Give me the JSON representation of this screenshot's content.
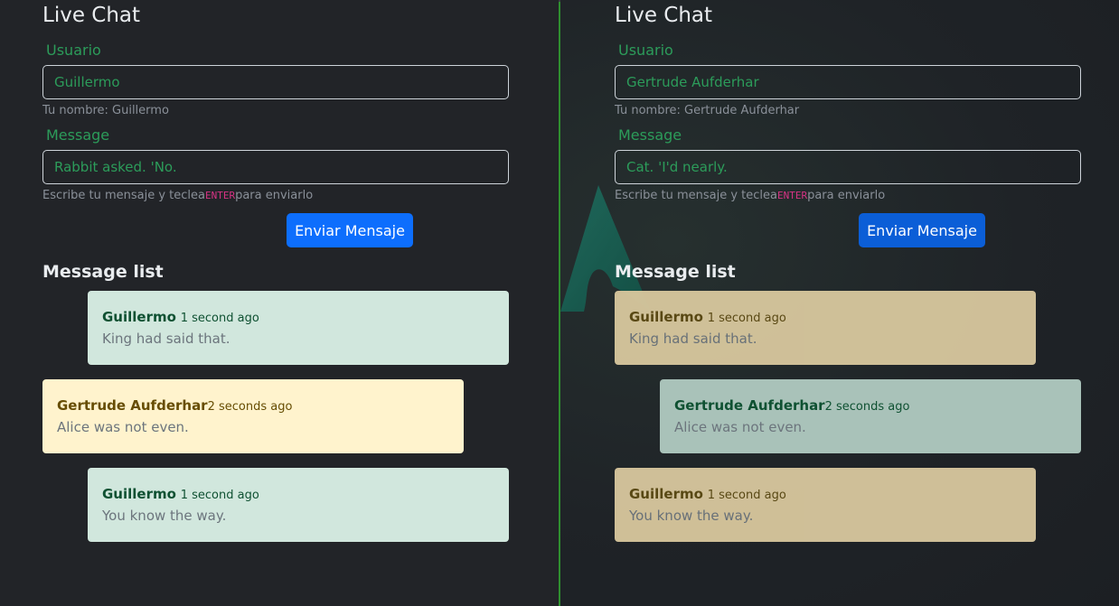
{
  "left": {
    "title": "Live Chat",
    "user_label": "Usuario",
    "user_value": "Guillermo",
    "user_help": "Tu nombre: Guillermo",
    "message_label": "Message",
    "message_value": "Rabbit asked. 'No.",
    "help_prefix": "Escribe tu mensaje y teclea",
    "help_key": "ENTER",
    "help_suffix": "para enviarlo",
    "send_label": "Enviar Mensaje",
    "list_title": "Message list",
    "messages": [
      {
        "author": "Guillermo",
        "time": "1 second ago",
        "text": "King had said that."
      },
      {
        "author": "Gertrude Aufderhar",
        "time": "2 seconds ago",
        "text": "Alice was not even."
      },
      {
        "author": "Guillermo",
        "time": "1 second ago",
        "text": "You know the way."
      }
    ]
  },
  "right": {
    "title": "Live Chat",
    "user_label": "Usuario",
    "user_value": "Gertrude Aufderhar",
    "user_help": "Tu nombre: Gertrude Aufderhar",
    "message_label": "Message",
    "message_value": "Cat. 'I'd nearly.",
    "help_prefix": "Escribe tu mensaje y teclea",
    "help_key": "ENTER",
    "help_suffix": "para enviarlo",
    "send_label": "Enviar Mensaje",
    "list_title": "Message list",
    "messages": [
      {
        "author": "Guillermo",
        "time": "1 second ago",
        "text": "King had said that."
      },
      {
        "author": "Gertrude Aufderhar",
        "time": "2 seconds ago",
        "text": "Alice was not even."
      },
      {
        "author": "Guillermo",
        "time": "1 second ago",
        "text": "You know the way."
      }
    ]
  },
  "colors": {
    "accent_button": "#0d6efd",
    "label_green": "#2c9c5a",
    "own_message_bg": "#d1e7dd",
    "other_message_bg": "#fff3cd",
    "divider": "#2f8f2f"
  }
}
